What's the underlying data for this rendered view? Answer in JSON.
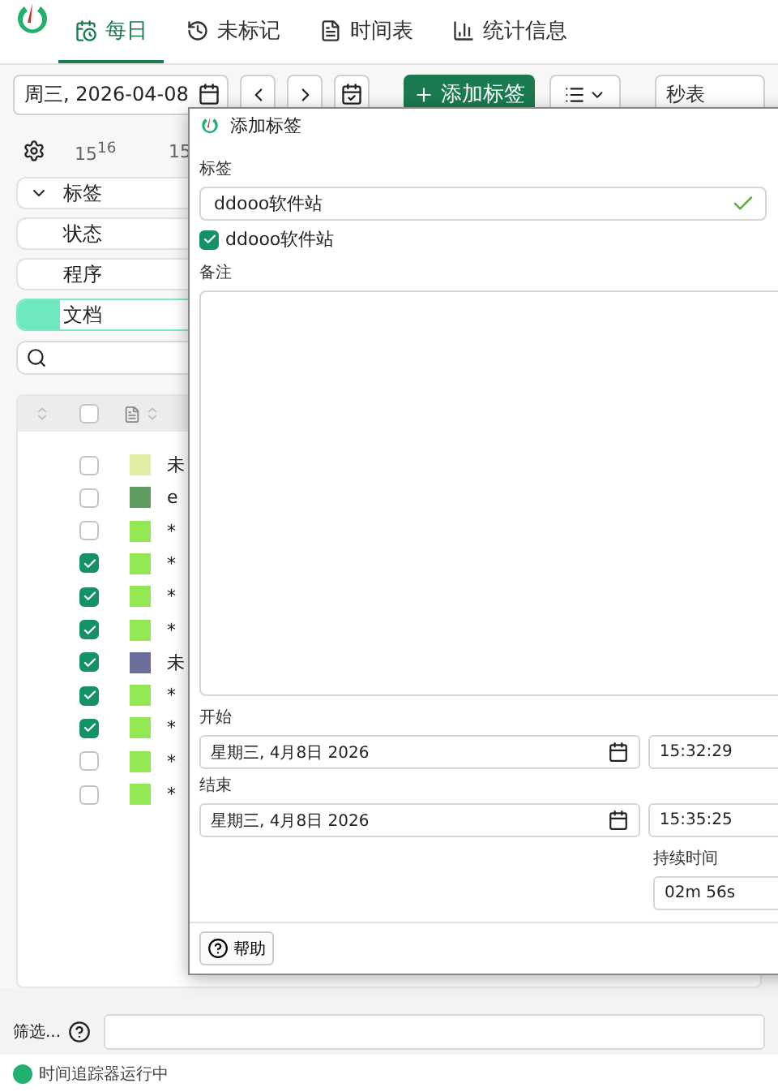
{
  "tabs": [
    {
      "label": "每日",
      "selected": true,
      "kind": "daily"
    },
    {
      "label": "未标记",
      "selected": false,
      "kind": "untagged"
    },
    {
      "label": "时间表",
      "selected": false,
      "kind": "timesheet"
    },
    {
      "label": "统计信息",
      "selected": false,
      "kind": "stats"
    }
  ],
  "toolbar": {
    "date": "周三, 2026-04-08",
    "add_button": "添加标签",
    "stopwatch": "秒表"
  },
  "timeline": {
    "ticks": [
      {
        "hour": "15",
        "minute": "16"
      },
      {
        "hour": "15"
      }
    ]
  },
  "filters": [
    {
      "label": "标签",
      "kind": "group",
      "selected": false
    },
    {
      "label": "状态",
      "kind": "item",
      "selected": false
    },
    {
      "label": "程序",
      "kind": "item",
      "selected": false
    },
    {
      "label": "文档",
      "kind": "item",
      "selected": true
    }
  ],
  "table": {
    "all_checked": false,
    "rows": [
      {
        "checked": false,
        "color": "#e2eea4",
        "text": "未"
      },
      {
        "checked": false,
        "color": "#5e9a60",
        "text": "e"
      },
      {
        "checked": false,
        "color": "#94e854",
        "text": "*"
      },
      {
        "checked": true,
        "color": "#94e854",
        "text": "*"
      },
      {
        "checked": true,
        "color": "#94e854",
        "text": "*"
      },
      {
        "checked": true,
        "color": "#94e854",
        "text": "*"
      },
      {
        "checked": true,
        "color": "#6a6e98",
        "text": "未"
      },
      {
        "checked": true,
        "color": "#94e854",
        "text": "*"
      },
      {
        "checked": true,
        "color": "#94e854",
        "text": "*"
      },
      {
        "checked": false,
        "color": "#94e854",
        "text": "*"
      },
      {
        "checked": false,
        "color": "#94e854",
        "text": "*"
      }
    ]
  },
  "filter_bar": {
    "label": "筛选..."
  },
  "status_bar": {
    "text": "时间追踪器运行中",
    "running": true
  },
  "dialog": {
    "title": "添加标签",
    "tag_label": "标签",
    "tag_value": "ddooo软件站",
    "tag_valid": true,
    "checkbox": {
      "label": "ddooo软件站",
      "checked": true
    },
    "note_label": "备注",
    "start_label": "开始",
    "start_date": "星期三, 4月8日 2026",
    "start_time": "15:32:29",
    "end_label": "结束",
    "end_date": "星期三, 4月8日 2026",
    "end_time": "15:35:25",
    "duration_label": "持续时间",
    "duration": "02m 56s",
    "help": "帮助"
  }
}
